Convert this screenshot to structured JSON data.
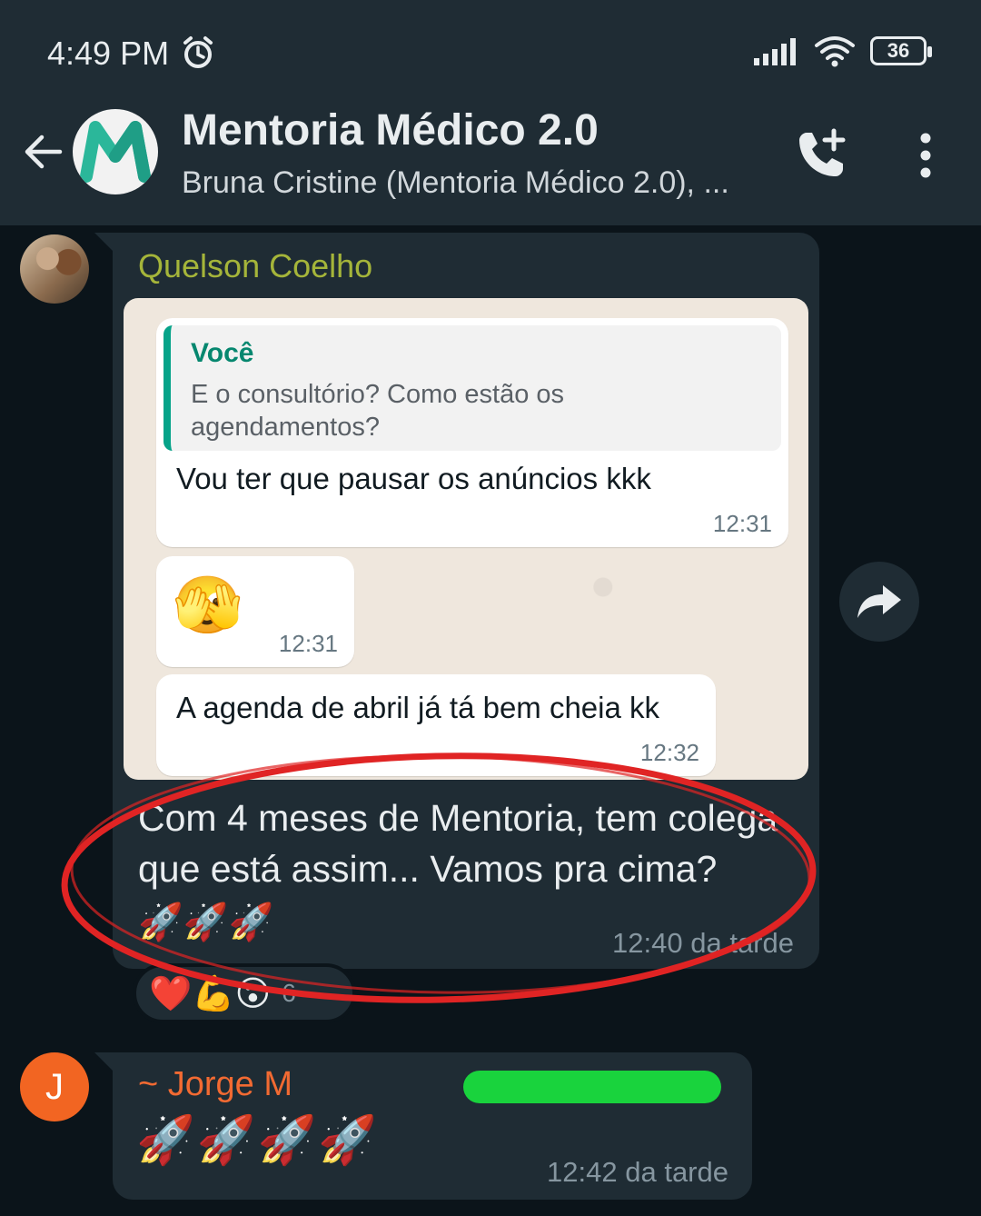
{
  "status_bar": {
    "time": "4:49 PM",
    "battery": "36"
  },
  "chat_header": {
    "title": "Mentoria Médico 2.0",
    "subtitle": "Bruna Cristine (Mentoria Médico 2.0), ..."
  },
  "messages": [
    {
      "sender": "Quelson Coelho",
      "screenshot": {
        "quote_name": "Você",
        "quote_text": "E o consultório? Como estão os agendamentos?",
        "msg1_text": "Vou ter que pausar os anúncios kkk",
        "msg1_time": "12:31",
        "msg2_emoji": "🫣",
        "msg2_time": "12:31",
        "msg3_text": "A agenda de abril já tá bem cheia kk",
        "msg3_time": "12:32"
      },
      "text": "Com 4 meses de Mentoria, tem colega que está assim... Vamos pra cima?",
      "emojis": "🚀🚀🚀",
      "time": "12:40 da tarde",
      "reactions": {
        "emojis": "❤️💪😮",
        "count": "6"
      }
    },
    {
      "sender": "~ Jorge M",
      "avatar_letter": "J",
      "emojis": "🚀🚀🚀🚀",
      "time": "12:42 da tarde"
    }
  ],
  "colors": {
    "background": "#0b141a",
    "bar": "#1f2c34",
    "incoming_bubble": "#1f2c34",
    "sender1": "#a5b53a",
    "sender2": "#f26a32",
    "highlight_circle": "#e02424",
    "redaction": "#19d33d"
  },
  "icons": [
    "alarm-icon",
    "signal-icon",
    "wifi-icon",
    "battery-icon",
    "back-arrow-icon",
    "add-call-icon",
    "more-vert-icon",
    "forward-icon"
  ]
}
